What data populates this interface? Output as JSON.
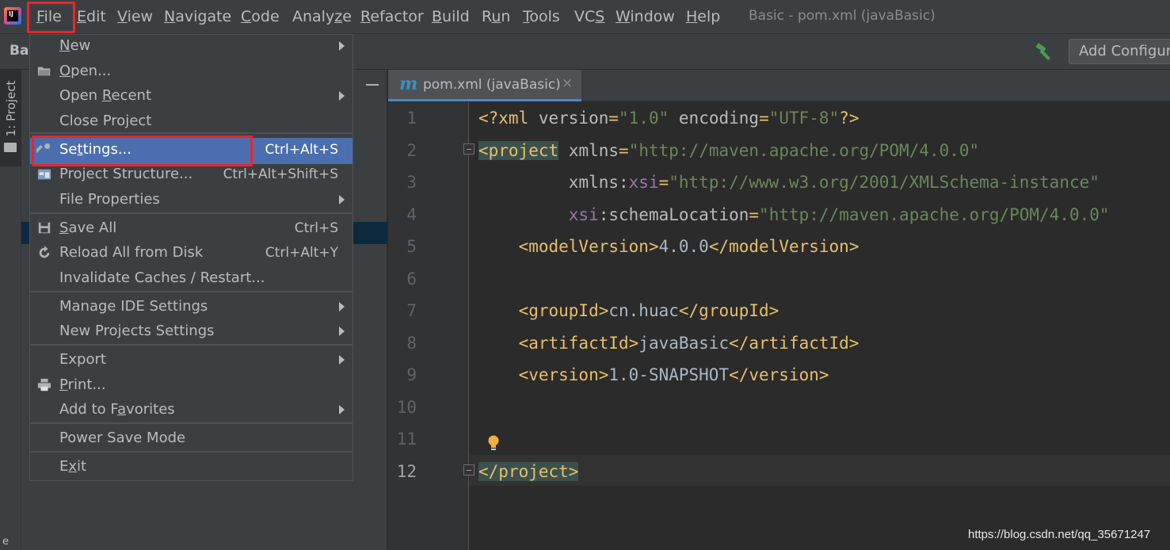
{
  "window_title": "Basic - pom.xml (javaBasic)",
  "app_logo_text": "IJ",
  "menubar": [
    {
      "before": "",
      "mnemonic": "F",
      "after": "ile"
    },
    {
      "before": "",
      "mnemonic": "E",
      "after": "dit"
    },
    {
      "before": "",
      "mnemonic": "V",
      "after": "iew"
    },
    {
      "before": "",
      "mnemonic": "N",
      "after": "avigate"
    },
    {
      "before": "",
      "mnemonic": "C",
      "after": "ode"
    },
    {
      "before": "Analy",
      "mnemonic": "z",
      "after": "e"
    },
    {
      "before": "",
      "mnemonic": "R",
      "after": "efactor"
    },
    {
      "before": "",
      "mnemonic": "B",
      "after": "uild"
    },
    {
      "before": "R",
      "mnemonic": "u",
      "after": "n"
    },
    {
      "before": "",
      "mnemonic": "T",
      "after": "ools"
    },
    {
      "before": "VC",
      "mnemonic": "S",
      "after": ""
    },
    {
      "before": "",
      "mnemonic": "W",
      "after": "indow"
    },
    {
      "before": "",
      "mnemonic": "H",
      "after": "elp"
    }
  ],
  "toolbar": {
    "breadcrumb": "Bas",
    "add_configuration_label": "Add Configuration...",
    "hammer_icon": "hammer-icon"
  },
  "tool_window": {
    "project_tab_label": "1: Project",
    "bottom_letter": "e"
  },
  "editor_tab": {
    "icon_letter": "m",
    "label": "pom.xml (javaBasic)",
    "close": "×"
  },
  "file_menu": {
    "items": [
      {
        "before": "",
        "mnemonic": "N",
        "after": "ew",
        "shortcut": "",
        "submenu": true,
        "icon": ""
      },
      {
        "before": "",
        "mnemonic": "O",
        "after": "pen...",
        "shortcut": "",
        "submenu": false,
        "icon": "folder-open-icon"
      },
      {
        "before": "Open ",
        "mnemonic": "R",
        "after": "ecent",
        "shortcut": "",
        "submenu": true,
        "icon": ""
      },
      {
        "before": "Close Project",
        "mnemonic": "",
        "after": "",
        "shortcut": "",
        "submenu": false,
        "icon": ""
      },
      {
        "before": "Se",
        "mnemonic": "t",
        "after": "tings...",
        "shortcut": "Ctrl+Alt+S",
        "submenu": false,
        "icon": "wrench-icon",
        "selected": true
      },
      {
        "before": "Project Structure...",
        "mnemonic": "",
        "after": "",
        "shortcut": "Ctrl+Alt+Shift+S",
        "submenu": false,
        "icon": "project-structure-icon"
      },
      {
        "before": "File Properties",
        "mnemonic": "",
        "after": "",
        "shortcut": "",
        "submenu": true,
        "icon": ""
      },
      {
        "before": "",
        "mnemonic": "S",
        "after": "ave All",
        "shortcut": "Ctrl+S",
        "submenu": false,
        "icon": "save-icon"
      },
      {
        "before": "Reload All from Disk",
        "mnemonic": "",
        "after": "",
        "shortcut": "Ctrl+Alt+Y",
        "submenu": false,
        "icon": "reload-icon"
      },
      {
        "before": "Invalidate Caches / Restart...",
        "mnemonic": "",
        "after": "",
        "shortcut": "",
        "submenu": false,
        "icon": ""
      },
      {
        "before": "Manage IDE Settings",
        "mnemonic": "",
        "after": "",
        "shortcut": "",
        "submenu": true,
        "icon": ""
      },
      {
        "before": "New Projects Settings",
        "mnemonic": "",
        "after": "",
        "shortcut": "",
        "submenu": true,
        "icon": ""
      },
      {
        "before": "Export",
        "mnemonic": "",
        "after": "",
        "shortcut": "",
        "submenu": true,
        "icon": ""
      },
      {
        "before": "",
        "mnemonic": "P",
        "after": "rint...",
        "shortcut": "",
        "submenu": false,
        "icon": "print-icon"
      },
      {
        "before": "Add to F",
        "mnemonic": "a",
        "after": "vorites",
        "shortcut": "",
        "submenu": true,
        "icon": ""
      },
      {
        "before": "Power Save Mode",
        "mnemonic": "",
        "after": "",
        "shortcut": "",
        "submenu": false,
        "icon": ""
      },
      {
        "before": "E",
        "mnemonic": "x",
        "after": "it",
        "shortcut": "",
        "submenu": false,
        "icon": ""
      }
    ]
  },
  "editor": {
    "current_line": 12,
    "line_numbers": [
      "1",
      "2",
      "3",
      "4",
      "5",
      "6",
      "7",
      "8",
      "9",
      "10",
      "11",
      "12"
    ],
    "lines": [
      [
        {
          "t": "<?xml ",
          "c": "tag"
        },
        {
          "t": "version",
          "c": "attr"
        },
        {
          "t": "=",
          "c": "tag"
        },
        {
          "t": "\"1.0\"",
          "c": "val"
        },
        {
          "t": " ",
          "c": "txt"
        },
        {
          "t": "encoding",
          "c": "attr"
        },
        {
          "t": "=",
          "c": "tag"
        },
        {
          "t": "\"UTF-8\"",
          "c": "val"
        },
        {
          "t": "?>",
          "c": "tag"
        }
      ],
      [
        {
          "t": "<project",
          "c": "tag hl"
        },
        {
          "t": " ",
          "c": "txt"
        },
        {
          "t": "xmlns",
          "c": "attr"
        },
        {
          "t": "=",
          "c": "tag"
        },
        {
          "t": "\"http://maven.apache.org/POM/4.0.0\"",
          "c": "val"
        }
      ],
      [
        {
          "t": "         ",
          "c": "txt"
        },
        {
          "t": "xmlns:",
          "c": "attr"
        },
        {
          "t": "xsi",
          "c": "ns"
        },
        {
          "t": "=",
          "c": "tag"
        },
        {
          "t": "\"http://www.w3.org/2001/XMLSchema-instance\"",
          "c": "val"
        }
      ],
      [
        {
          "t": "         ",
          "c": "txt"
        },
        {
          "t": "xsi",
          "c": "ns"
        },
        {
          "t": ":schemaLocation",
          "c": "attr"
        },
        {
          "t": "=",
          "c": "tag"
        },
        {
          "t": "\"http://maven.apache.org/POM/4.0.0\"",
          "c": "val"
        }
      ],
      [
        {
          "t": "    ",
          "c": "txt"
        },
        {
          "t": "<modelVersion>",
          "c": "tag"
        },
        {
          "t": "4.0.0",
          "c": "txt"
        },
        {
          "t": "</modelVersion>",
          "c": "tag"
        }
      ],
      [],
      [
        {
          "t": "    ",
          "c": "txt"
        },
        {
          "t": "<groupId>",
          "c": "tag"
        },
        {
          "t": "cn.huac",
          "c": "txt"
        },
        {
          "t": "</groupId>",
          "c": "tag"
        }
      ],
      [
        {
          "t": "    ",
          "c": "txt"
        },
        {
          "t": "<artifactId>",
          "c": "tag"
        },
        {
          "t": "javaBasic",
          "c": "txt"
        },
        {
          "t": "</artifactId>",
          "c": "tag"
        }
      ],
      [
        {
          "t": "    ",
          "c": "txt"
        },
        {
          "t": "<version>",
          "c": "tag"
        },
        {
          "t": "1.0-SNAPSHOT",
          "c": "txt"
        },
        {
          "t": "</version>",
          "c": "tag"
        }
      ],
      [],
      [],
      [
        {
          "t": "</project>",
          "c": "tag hl"
        }
      ]
    ]
  },
  "watermark": "https://blog.csdn.net/qq_35671247",
  "colors": {
    "accent_selection": "#4b6eaf",
    "highlight_box": "#e8262c",
    "xml_tag": "#e8bf6a",
    "xml_value": "#6a8759",
    "xml_namespace": "#9876aa"
  }
}
